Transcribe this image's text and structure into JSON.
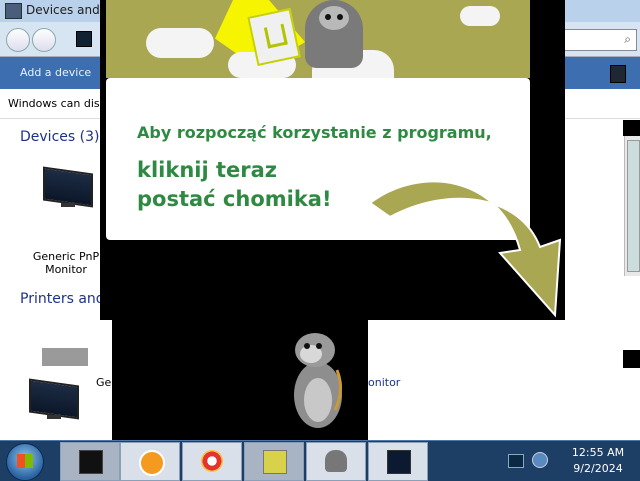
{
  "window": {
    "title": "Devices and P",
    "command_add": "Add a device",
    "info_text": "Windows can disp",
    "sections": {
      "devices_title": "Devices (3)",
      "printers_title": "Printers and"
    },
    "devices": [
      {
        "label_line1": "Generic PnP",
        "label_line2": "Monitor"
      }
    ],
    "partial_labels": {
      "left": "Ge",
      "right": "onitor"
    }
  },
  "popup": {
    "line1": "Aby rozpocząć korzystanie z programu,",
    "line2": "kliknij teraz",
    "line3": "postać chomika!",
    "colors": {
      "text": "#2e8a42",
      "banner": "#a9a751",
      "arrow": "#a9a751"
    }
  },
  "taskbar": {
    "clock_time": "12:55 AM",
    "clock_date": "9/2/2024",
    "items": [
      {
        "name": "devices-printers-icon"
      },
      {
        "name": "media-player-icon"
      },
      {
        "name": "browser-icon"
      },
      {
        "name": "chomikuj-app-icon"
      },
      {
        "name": "marmot-mascot-icon"
      },
      {
        "name": "display-icon"
      }
    ]
  }
}
